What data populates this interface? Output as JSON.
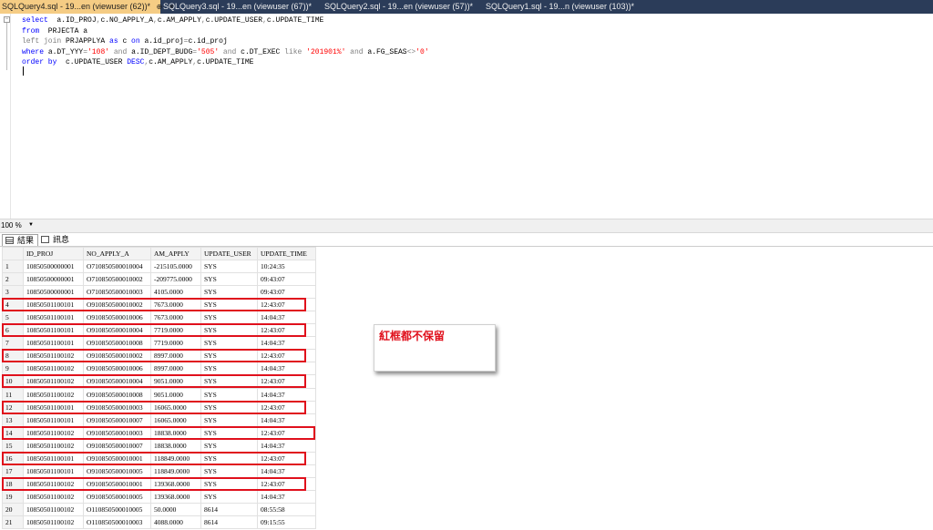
{
  "tabs": [
    {
      "label": "SQLQuery4.sql - 19...en (viewuser (62))*",
      "active": true
    },
    {
      "label": "SQLQuery3.sql - 19...en (viewuser (67))*",
      "active": false
    },
    {
      "label": "SQLQuery2.sql - 19...en (viewuser (57))*",
      "active": false
    },
    {
      "label": "SQLQuery1.sql - 19...n (viewuser (103))*",
      "active": false
    }
  ],
  "tab_icons": {
    "pin": "pin-icon",
    "close": "close-icon"
  },
  "editor": {
    "lines": [
      [
        {
          "t": "select",
          "c": "kw"
        },
        {
          "t": "  a.ID_PROJ",
          "c": ""
        },
        {
          "t": ",",
          "c": "gr"
        },
        {
          "t": "c.NO_APPLY_A",
          "c": ""
        },
        {
          "t": ",",
          "c": "gr"
        },
        {
          "t": "c.AM_APPLY",
          "c": ""
        },
        {
          "t": ",",
          "c": "gr"
        },
        {
          "t": "c.UPDATE_USER",
          "c": ""
        },
        {
          "t": ",",
          "c": "gr"
        },
        {
          "t": "c.UPDATE_TIME",
          "c": ""
        }
      ],
      [
        {
          "t": "from",
          "c": "kw"
        },
        {
          "t": "  PRJECTA a",
          "c": ""
        }
      ],
      [
        {
          "t": "left join",
          "c": "gr"
        },
        {
          "t": " PRJAPPLYA ",
          "c": ""
        },
        {
          "t": "as",
          "c": "kw"
        },
        {
          "t": " c ",
          "c": ""
        },
        {
          "t": "on",
          "c": "kw"
        },
        {
          "t": " a.id_proj",
          "c": ""
        },
        {
          "t": "=",
          "c": "gr"
        },
        {
          "t": "c.id_proj",
          "c": ""
        }
      ],
      [
        {
          "t": "where",
          "c": "kw"
        },
        {
          "t": " a.DT_YYY",
          "c": ""
        },
        {
          "t": "=",
          "c": "gr"
        },
        {
          "t": "'108'",
          "c": "st"
        },
        {
          "t": " and ",
          "c": "gr"
        },
        {
          "t": "a.ID_DEPT_BUDG",
          "c": ""
        },
        {
          "t": "=",
          "c": "gr"
        },
        {
          "t": "'505'",
          "c": "st"
        },
        {
          "t": " and ",
          "c": "gr"
        },
        {
          "t": "c.DT_EXEC ",
          "c": ""
        },
        {
          "t": "like",
          "c": "gr"
        },
        {
          "t": " '201901%'",
          "c": "st"
        },
        {
          "t": " and ",
          "c": "gr"
        },
        {
          "t": "a.FG_SEAS",
          "c": ""
        },
        {
          "t": "<>",
          "c": "gr"
        },
        {
          "t": "'0'",
          "c": "st"
        }
      ],
      [
        {
          "t": "order by",
          "c": "kw"
        },
        {
          "t": "  c.UPDATE_USER ",
          "c": ""
        },
        {
          "t": "DESC",
          "c": "kw"
        },
        {
          "t": ",",
          "c": "gr"
        },
        {
          "t": "c.AM_APPLY",
          "c": ""
        },
        {
          "t": ",",
          "c": "gr"
        },
        {
          "t": "c.UPDATE_TIME",
          "c": ""
        }
      ]
    ]
  },
  "zoom": {
    "value": "100 %"
  },
  "result_tabs": [
    {
      "label": "結果",
      "icon": "grid-icon"
    },
    {
      "label": "訊息",
      "icon": "message-icon"
    }
  ],
  "grid": {
    "columns": [
      "ID_PROJ",
      "NO_APPLY_A",
      "AM_APPLY",
      "UPDATE_USER",
      "UPDATE_TIME"
    ],
    "rows": [
      [
        "1",
        "10850500000001",
        "O710850500010004",
        "-215105.0000",
        "SYS",
        "10:24:35"
      ],
      [
        "2",
        "10850500000001",
        "O710850500010002",
        "-209775.0000",
        "SYS",
        "09:43:07"
      ],
      [
        "3",
        "10850500000001",
        "O710850500010003",
        "4105.0000",
        "SYS",
        "09:43:07"
      ],
      [
        "4",
        "10850501100101",
        "O910850500010002",
        "7673.0000",
        "SYS",
        "12:43:07"
      ],
      [
        "5",
        "10850501100101",
        "O910850500010006",
        "7673.0000",
        "SYS",
        "14:04:37"
      ],
      [
        "6",
        "10850501100101",
        "O910850500010004",
        "7719.0000",
        "SYS",
        "12:43:07"
      ],
      [
        "7",
        "10850501100101",
        "O910850500010008",
        "7719.0000",
        "SYS",
        "14:04:37"
      ],
      [
        "8",
        "10850501100102",
        "O910850500010002",
        "8997.0000",
        "SYS",
        "12:43:07"
      ],
      [
        "9",
        "10850501100102",
        "O910850500010006",
        "8997.0000",
        "SYS",
        "14:04:37"
      ],
      [
        "10",
        "10850501100102",
        "O910850500010004",
        "9051.0000",
        "SYS",
        "12:43:07"
      ],
      [
        "11",
        "10850501100102",
        "O910850500010008",
        "9051.0000",
        "SYS",
        "14:04:37"
      ],
      [
        "12",
        "10850501100101",
        "O910850500010003",
        "16065.0000",
        "SYS",
        "12:43:07"
      ],
      [
        "13",
        "10850501100101",
        "O910850500010007",
        "16065.0000",
        "SYS",
        "14:04:37"
      ],
      [
        "14",
        "10850501100102",
        "O910850500010003",
        "18838.0000",
        "SYS",
        "12:43:07"
      ],
      [
        "15",
        "10850501100102",
        "O910850500010007",
        "18838.0000",
        "SYS",
        "14:04:37"
      ],
      [
        "16",
        "10850501100101",
        "O910850500010001",
        "118849.0000",
        "SYS",
        "12:43:07"
      ],
      [
        "17",
        "10850501100101",
        "O910850500010005",
        "118849.0000",
        "SYS",
        "14:04:37"
      ],
      [
        "18",
        "10850501100102",
        "O910850500010001",
        "139368.0000",
        "SYS",
        "12:43:07"
      ],
      [
        "19",
        "10850501100102",
        "O910850500010005",
        "139368.0000",
        "SYS",
        "14:04:37"
      ],
      [
        "20",
        "10850501100102",
        "O110850500010005",
        "50.0000",
        "8614",
        "08:55:58"
      ],
      [
        "21",
        "10850501100102",
        "O110850500010003",
        "4088.0000",
        "8614",
        "09:15:55"
      ]
    ],
    "highlighted_rows": [
      4,
      6,
      8,
      10,
      12,
      14,
      16,
      18
    ]
  },
  "annotation": {
    "text": "紅框都不保留",
    "color": "#e0101c"
  },
  "colors": {
    "tab_active": "#f5cc84",
    "tabbar": "#2b3c59",
    "keyword": "#0000ff",
    "string": "#ff0000",
    "highlight": "#e0101c"
  }
}
